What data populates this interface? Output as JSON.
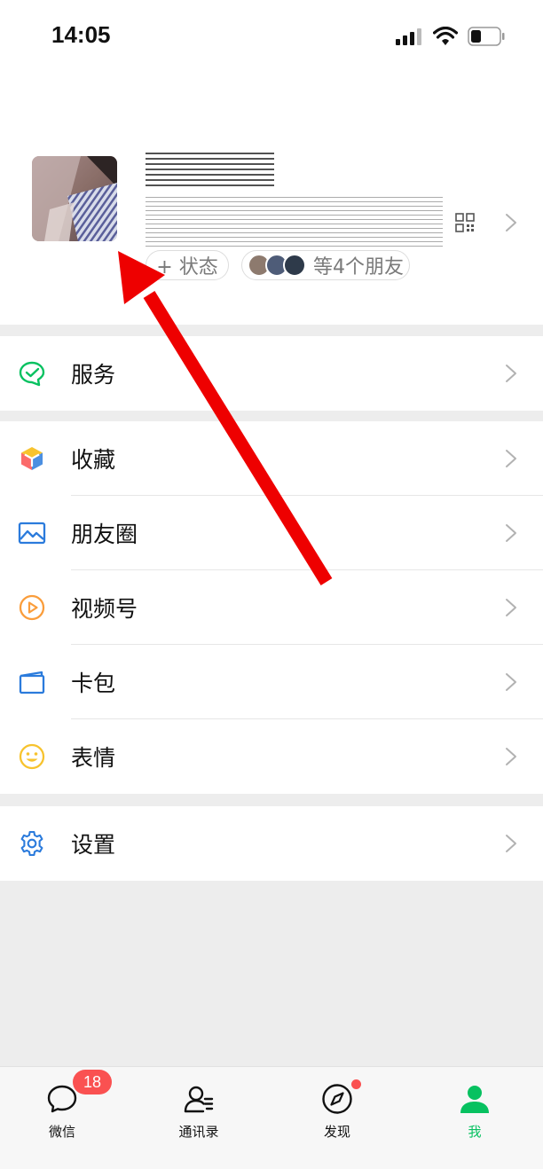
{
  "status_bar": {
    "time": "14:05"
  },
  "profile": {
    "status_button_label": "+ 状态",
    "friends_status_label": "等4个朋友"
  },
  "menu_groups": [
    {
      "items": [
        {
          "key": "services",
          "label": "服务",
          "icon": "chat-check-icon",
          "color": "#07c160"
        }
      ]
    },
    {
      "items": [
        {
          "key": "favorites",
          "label": "收藏",
          "icon": "cube-icon",
          "color": "#f5a623"
        },
        {
          "key": "moments",
          "label": "朋友圈",
          "icon": "picture-icon",
          "color": "#2b7bdc"
        },
        {
          "key": "channels",
          "label": "视频号",
          "icon": "play-circle-icon",
          "color": "#fa9d3b"
        },
        {
          "key": "cards",
          "label": "卡包",
          "icon": "wallet-icon",
          "color": "#2b7bdc"
        },
        {
          "key": "stickers",
          "label": "表情",
          "icon": "smiley-icon",
          "color": "#f7c32e"
        }
      ]
    },
    {
      "items": [
        {
          "key": "settings",
          "label": "设置",
          "icon": "gear-icon",
          "color": "#2b7bdc"
        }
      ]
    }
  ],
  "tabbar": {
    "tabs": [
      {
        "key": "chats",
        "label": "微信",
        "badge": "18"
      },
      {
        "key": "contacts",
        "label": "通讯录"
      },
      {
        "key": "discover",
        "label": "发现"
      },
      {
        "key": "me",
        "label": "我",
        "active": true
      }
    ]
  },
  "colors": {
    "accent": "#07c160",
    "badge": "#fa5151",
    "annotation_arrow": "#ee0000"
  }
}
